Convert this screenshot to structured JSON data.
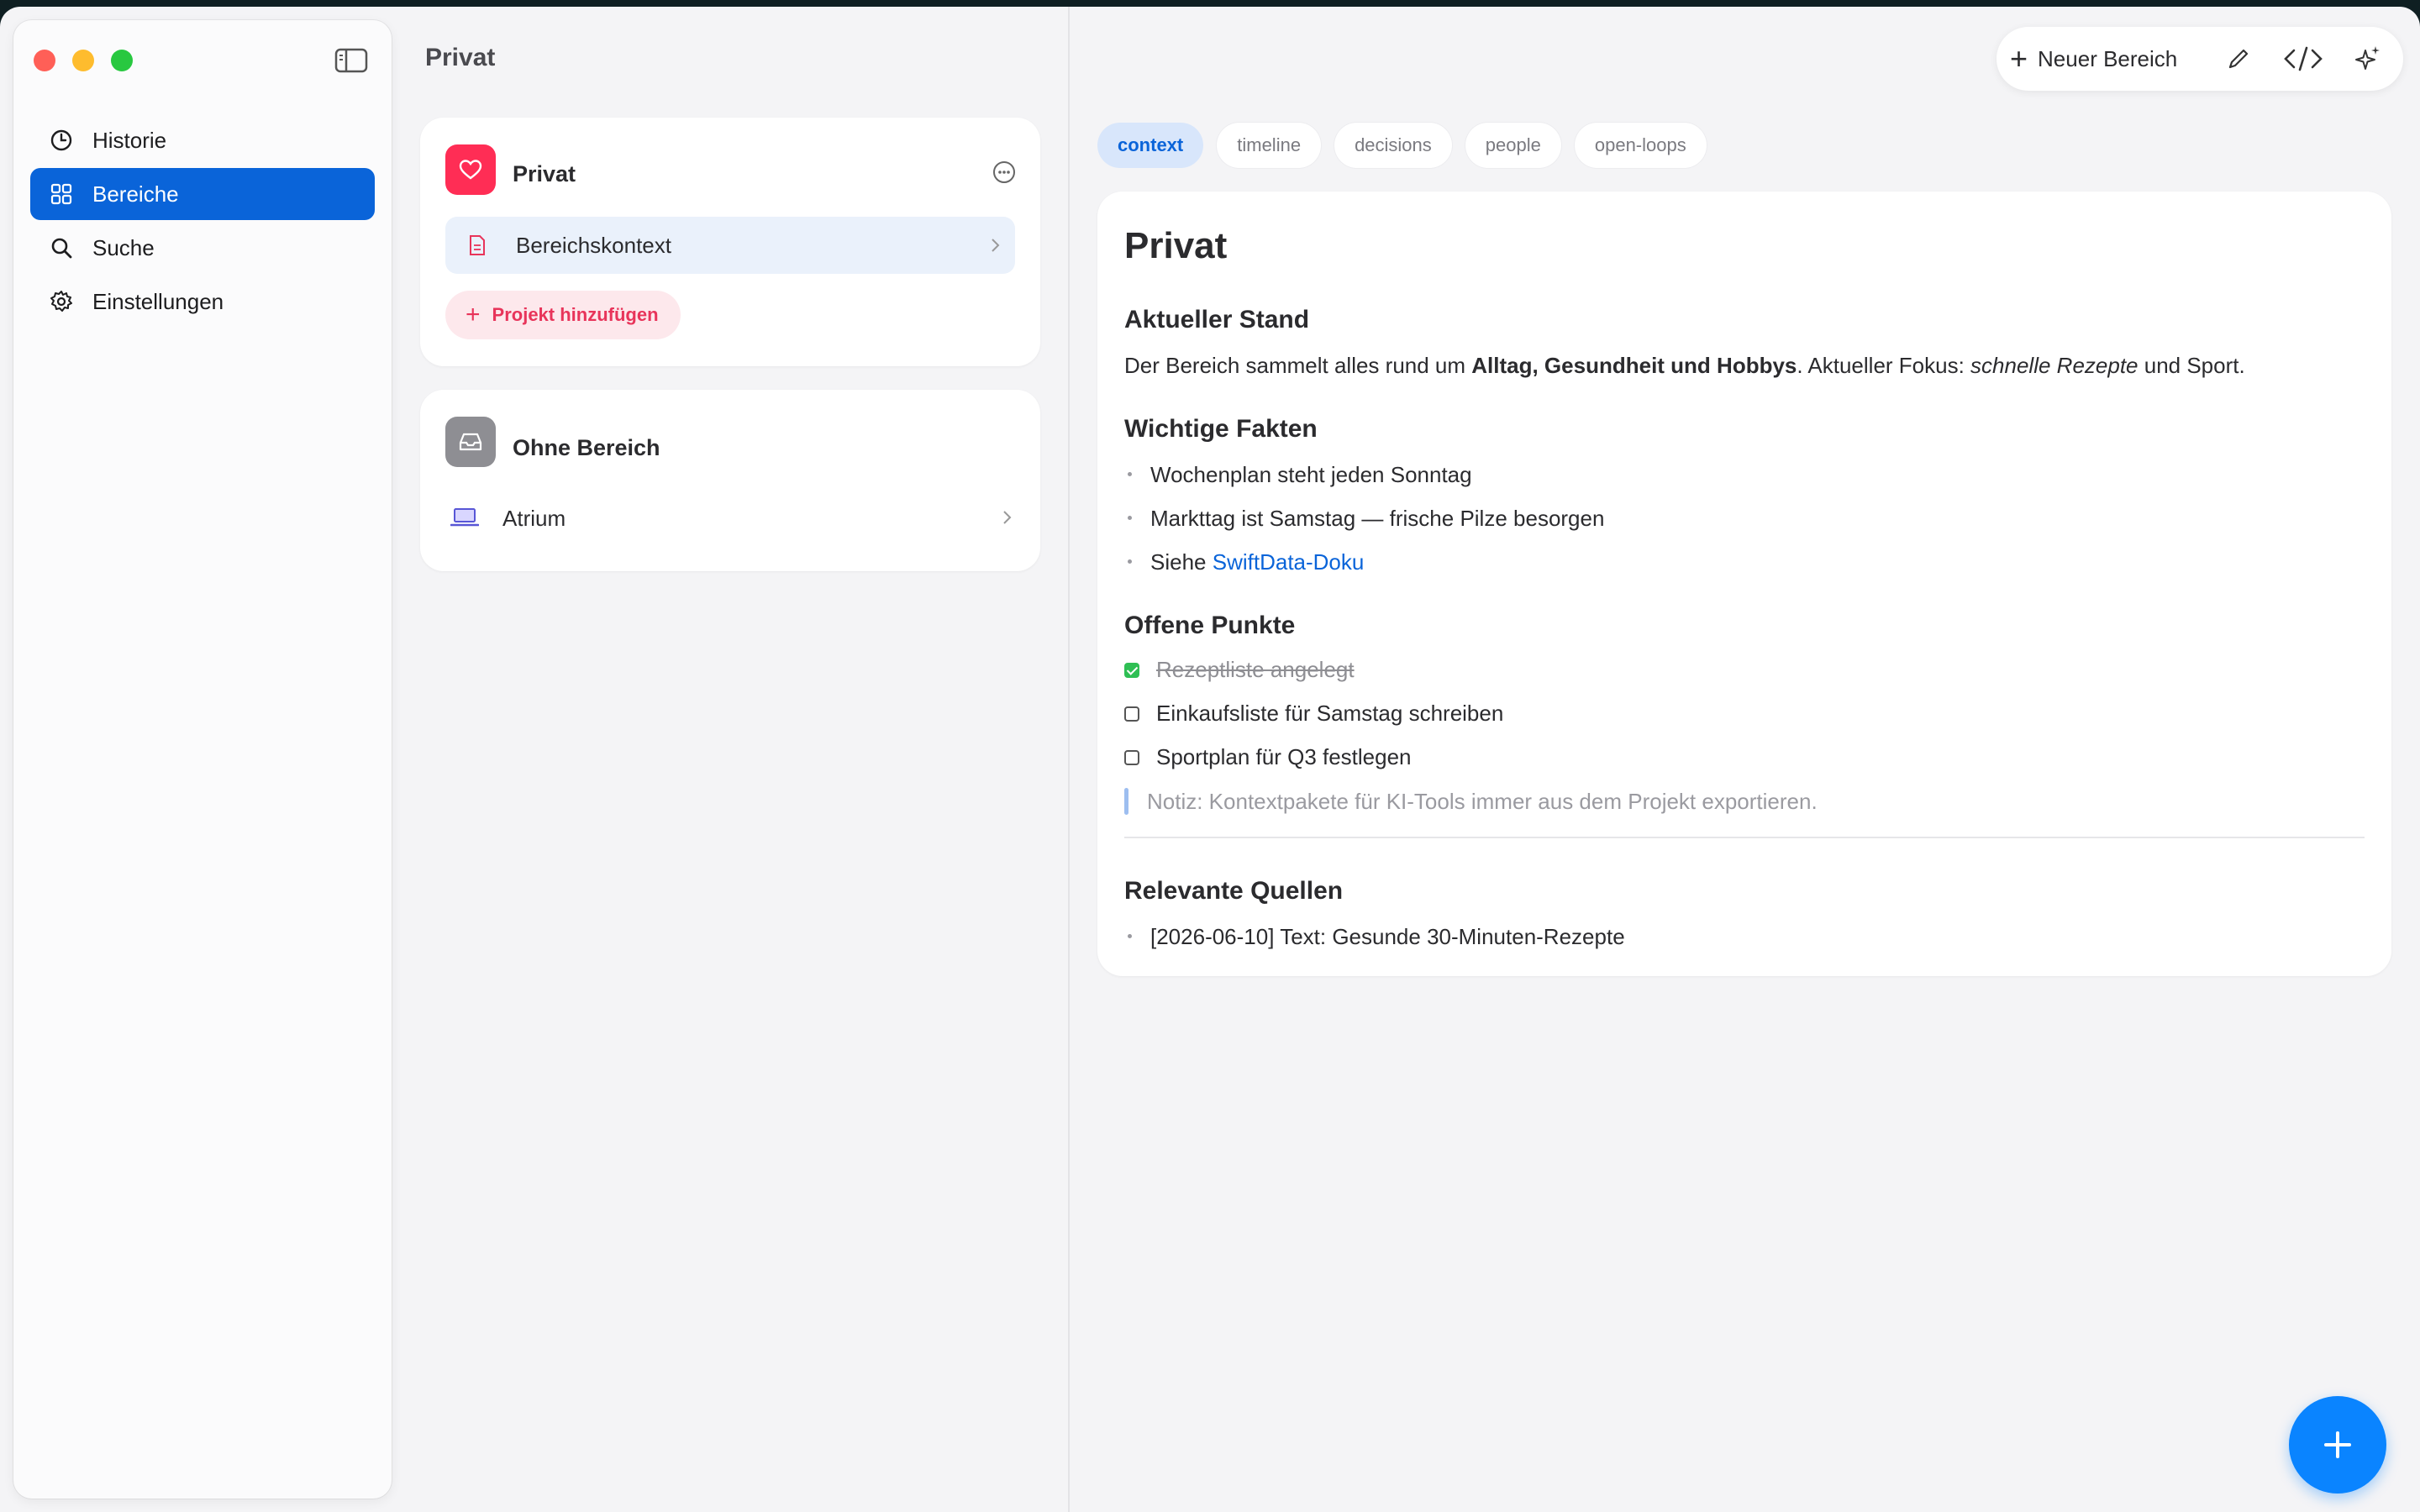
{
  "sidebar": {
    "items": [
      {
        "label": "Historie",
        "icon": "clock-icon"
      },
      {
        "label": "Bereiche",
        "icon": "grid-icon",
        "active": true
      },
      {
        "label": "Suche",
        "icon": "search-icon"
      },
      {
        "label": "Einstellungen",
        "icon": "gear-icon"
      }
    ]
  },
  "middle": {
    "title": "Privat",
    "area_card": {
      "title": "Privat",
      "icon": "heart-icon",
      "icon_color": "#ff2d55",
      "context_row": "Bereichskontext",
      "add_project": "Projekt hinzufügen"
    },
    "no_area_card": {
      "title": "Ohne Bereich",
      "icon": "tray-icon",
      "project": "Atrium"
    }
  },
  "toolbar": {
    "new_area": "Neuer Bereich"
  },
  "tabs": [
    "context",
    "timeline",
    "decisions",
    "people",
    "open-loops"
  ],
  "document": {
    "title": "Privat",
    "section_status": "Aktueller Stand",
    "status_pre": "Der Bereich sammelt alles rund um ",
    "status_bold": "Alltag, Gesundheit und Hobbys",
    "status_mid": ". Aktueller Fokus: ",
    "status_italic": "schnelle Rezepte",
    "status_post": " und Sport.",
    "section_facts": "Wichtige Fakten",
    "fact_1": "Wochenplan steht jeden Sonntag",
    "fact_2": "Markttag ist Samstag — frische Pilze besorgen",
    "fact_3_pre": "Siehe ",
    "fact_3_link": "SwiftData-Doku",
    "section_open": "Offene Punkte",
    "todo_1": "Rezeptliste angelegt",
    "todo_2": "Einkaufsliste für Samstag schreiben",
    "todo_3": "Sportplan für Q3 festlegen",
    "note": "Notiz: Kontextpakete für KI-Tools immer aus dem Projekt exportieren.",
    "section_sources": "Relevante Quellen",
    "source_1": "[2026-06-10] Text: Gesunde 30-Minuten-Rezepte"
  },
  "colors": {
    "accent": "#0a64d9",
    "fab": "#0a84ff",
    "pink": "#e8345a"
  }
}
